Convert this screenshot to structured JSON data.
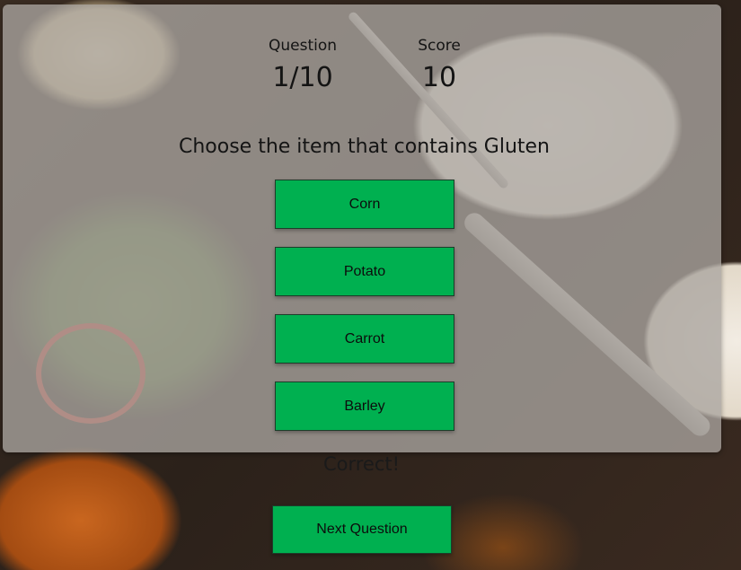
{
  "quiz": {
    "question_label": "Question",
    "question_value": "1/10",
    "score_label": "Score",
    "score_value": "10",
    "prompt": "Choose the item that contains Gluten",
    "answers": [
      "Corn",
      "Potato",
      "Carrot",
      "Barley"
    ],
    "feedback": "Correct!",
    "next_label": "Next Question"
  },
  "colors": {
    "button": "#00b050",
    "panel": "rgba(170,165,160,0.78)"
  }
}
